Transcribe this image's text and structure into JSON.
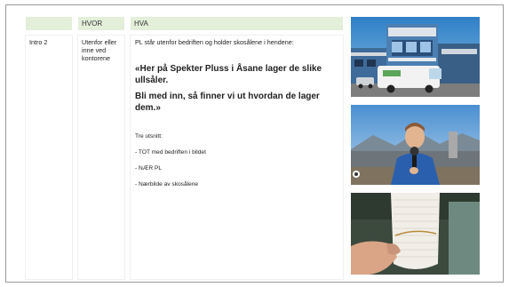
{
  "table": {
    "headers": [
      "",
      "HVOR",
      "HVA"
    ],
    "row": {
      "col1": "Intro 2",
      "col2": "Utenfor eller inne ved kontorene",
      "col3": {
        "description": "PL står utenfor bedriften og holder skosålene i hendene:",
        "quote_line1": "«Her på Spekter Pluss i Åsane lager de slike ullsåler.",
        "quote_line2": "Bli med inn, så finner vi ut hvordan de lager dem.»",
        "excerpts_title": "Tre utsnitt:",
        "excerpts": [
          "- TOT med bedriften i bildet",
          "- NÆR PL",
          "- Nærbilde av skosålene"
        ]
      }
    }
  },
  "images": {
    "photo1": "building-with-van",
    "photo2": "reporter-with-microphone",
    "photo3": "shoe-sole-closeup"
  },
  "colors": {
    "header_bg": "#e3efd9",
    "border": "#9a9a9a"
  }
}
